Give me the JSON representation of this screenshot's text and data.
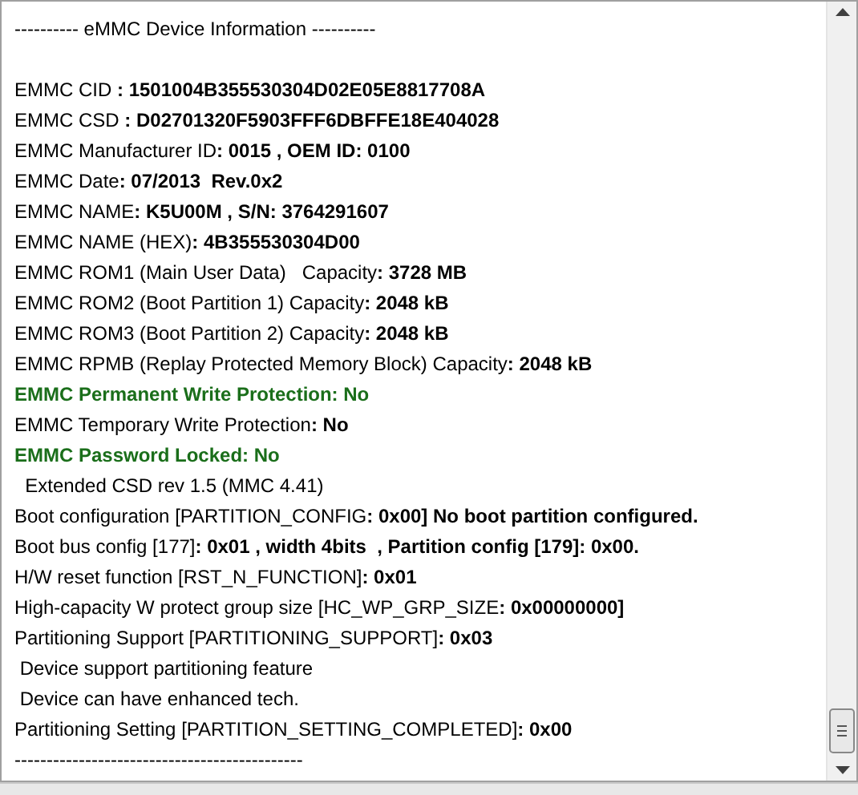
{
  "lines": [
    {
      "kind": "header",
      "text": "---------- eMMC Device Information ----------"
    },
    {
      "kind": "normal",
      "text": "EMMC CID **: 1501004B355530304D02E05E8817708A**"
    },
    {
      "kind": "normal",
      "text": "EMMC CSD **: D02701320F5903FFF6DBFFE18E404028**"
    },
    {
      "kind": "normal",
      "text": "EMMC Manufacturer ID**: 0015 , OEM ID: 0100**"
    },
    {
      "kind": "normal",
      "text": "EMMC Date**: 07/2013  Rev.0x2**"
    },
    {
      "kind": "normal",
      "text": "EMMC NAME**: K5U00M , S/N: 3764291607**"
    },
    {
      "kind": "normal",
      "text": "EMMC NAME (HEX)**: 4B355530304D00**"
    },
    {
      "kind": "normal",
      "text": "EMMC ROM1 (Main User Data)   Capacity**: 3728 MB**"
    },
    {
      "kind": "normal",
      "text": "EMMC ROM2 (Boot Partition 1) Capacity**: 2048 kB**"
    },
    {
      "kind": "normal",
      "text": "EMMC ROM3 (Boot Partition 2) Capacity**: 2048 kB**"
    },
    {
      "kind": "normal",
      "text": "EMMC RPMB (Replay Protected Memory Block) Capacity**: 2048 kB**"
    },
    {
      "kind": "highlight",
      "text": "EMMC Permanent Write Protection: No"
    },
    {
      "kind": "normal",
      "text": "EMMC Temporary Write Protection**: No**"
    },
    {
      "kind": "highlight",
      "text": "EMMC Password Locked: No"
    },
    {
      "kind": "normal",
      "text": "  Extended CSD rev 1.5 (MMC 4.41)"
    },
    {
      "kind": "normal",
      "text": "Boot configuration [PARTITION_CONFIG**: 0x00] No boot partition configured.**"
    },
    {
      "kind": "normal",
      "text": "Boot bus config [177]**: 0x01 , width 4bits  , Partition config [179]: 0x00.**"
    },
    {
      "kind": "normal",
      "text": "H/W reset function [RST_N_FUNCTION]**: 0x01**"
    },
    {
      "kind": "normal",
      "text": "High-capacity W protect group size [HC_WP_GRP_SIZE**: 0x00000000]**"
    },
    {
      "kind": "normal",
      "text": "Partitioning Support [PARTITIONING_SUPPORT]**: 0x03**"
    },
    {
      "kind": "normal",
      "text": " Device support partitioning feature"
    },
    {
      "kind": "normal",
      "text": " Device can have enhanced tech."
    },
    {
      "kind": "normal",
      "text": "Partitioning Setting [PARTITION_SETTING_COMPLETED]**: 0x00**"
    },
    {
      "kind": "normal",
      "text": "---------------------------------------------"
    }
  ]
}
